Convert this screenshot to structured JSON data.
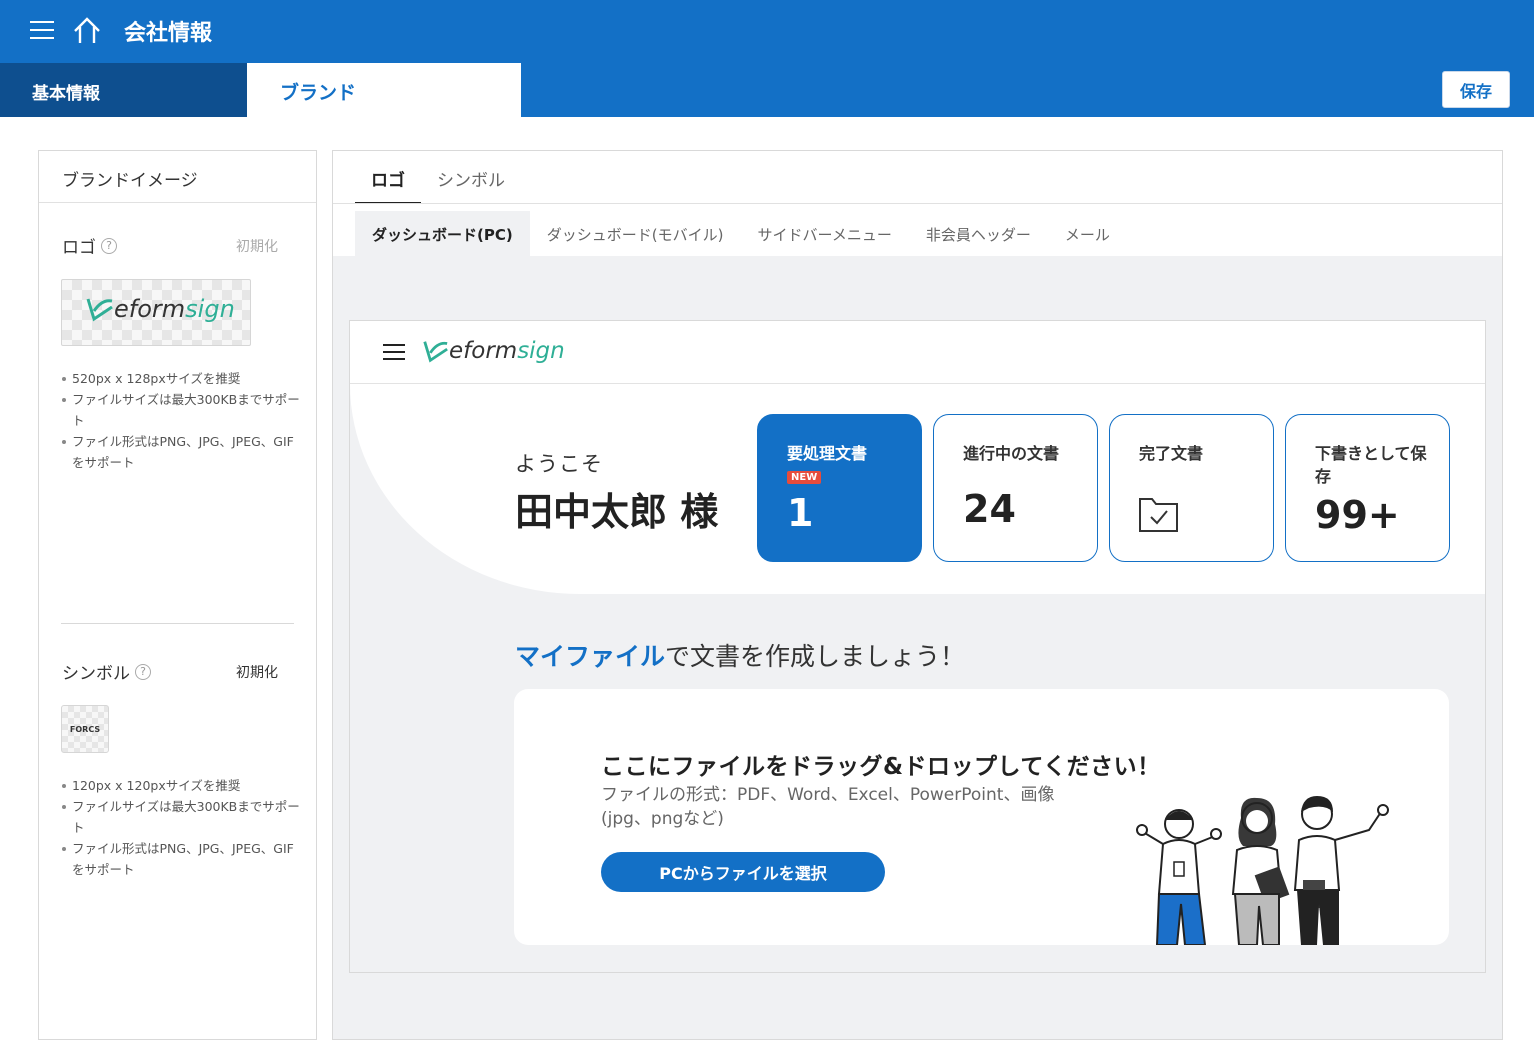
{
  "header": {
    "title": "会社情報"
  },
  "tabs": {
    "basic": "基本情報",
    "brand": "ブランド",
    "save": "保存"
  },
  "left": {
    "title": "ブランドイメージ",
    "logo": {
      "label": "ロゴ",
      "reset": "初期化",
      "brand_e": "eform",
      "brand_s": "sign",
      "notes": [
        "520px x 128pxサイズを推奨",
        "ファイルサイズは最大300KBまでサポート",
        "ファイル形式はPNG、JPG、JPEG、GIFをサポート"
      ]
    },
    "symbol": {
      "label": "シンボル",
      "reset": "初期化",
      "mark": "FORCS",
      "notes": [
        "120px x 120pxサイズを推奨",
        "ファイルサイズは最大300KBまでサポート",
        "ファイル形式はPNG、JPG、JPEG、GIFをサポート"
      ]
    },
    "help_glyph": "?"
  },
  "main": {
    "tabs": [
      "ロゴ",
      "シンボル"
    ],
    "subtabs": [
      "ダッシュボード(PC)",
      "ダッシュボード(モバイル)",
      "サイドバーメニュー",
      "非会員ヘッダー",
      "メール"
    ]
  },
  "preview": {
    "brand_e": "eform",
    "brand_s": "sign",
    "welcome": "ようこそ",
    "username": "田中太郎 様",
    "cards": [
      {
        "title": "要処理文書",
        "badge": "NEW",
        "value": "1"
      },
      {
        "title": "進行中の文書",
        "value": "24"
      },
      {
        "title": "完了文書",
        "icon": "folder-check-icon"
      },
      {
        "title": "下書きとして保存",
        "value": "99+"
      }
    ],
    "myfile_highlight": "マイファイル",
    "myfile_rest": "で文書を作成しましょう！",
    "drop_title": "ここにファイルをドラッグ&ドロップしてください！",
    "drop_desc": "ファイルの形式：PDF、Word、Excel、PowerPoint、画像(jpg、pngなど)",
    "select_button": "PCからファイルを選択"
  },
  "colors": {
    "primary": "#1370c6",
    "dark_tab": "#0e4f8f",
    "brand_green": "#2faf96",
    "badge_red": "#e74c3c"
  }
}
